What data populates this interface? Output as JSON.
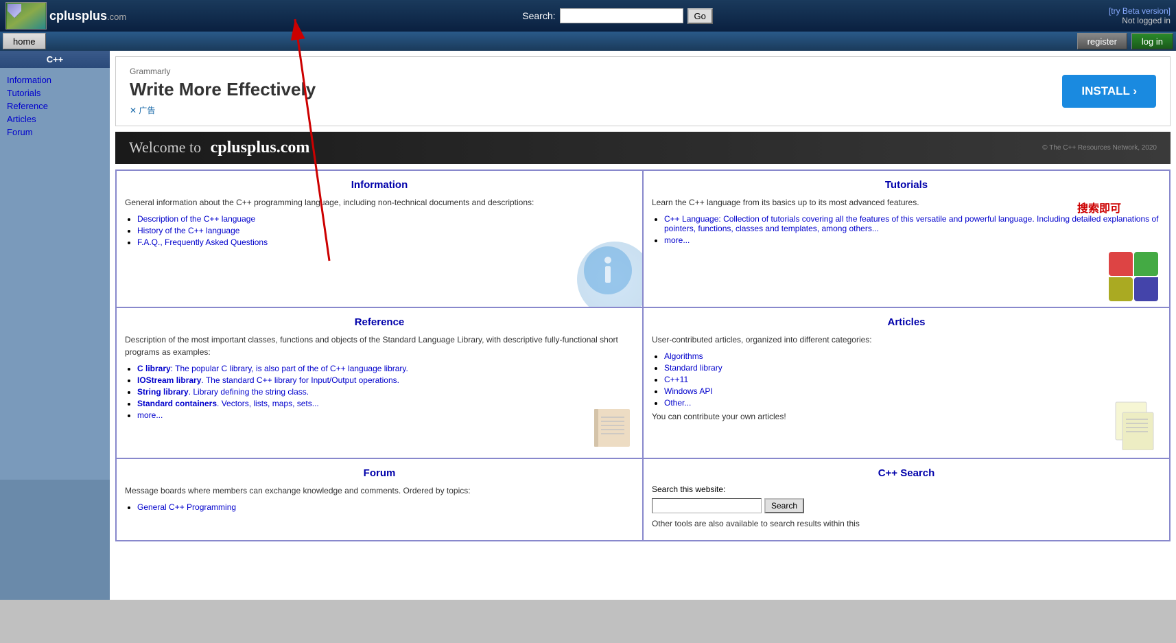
{
  "header": {
    "search_label": "Search:",
    "go_label": "Go",
    "beta_text": "[try Beta version]",
    "not_logged": "Not logged in",
    "home_label": "home",
    "register_label": "register",
    "login_label": "log in"
  },
  "logo": {
    "text": "cplusplus",
    "com": ".com"
  },
  "sidebar": {
    "title": "C++",
    "links": [
      {
        "label": "Information",
        "href": "#"
      },
      {
        "label": "Tutorials",
        "href": "#"
      },
      {
        "label": "Reference",
        "href": "#"
      },
      {
        "label": "Articles",
        "href": "#"
      },
      {
        "label": "Forum",
        "href": "#"
      }
    ]
  },
  "ad": {
    "brand": "Grammarly",
    "title": "Write More Effectively",
    "footer": "✕ 广告",
    "install_label": "INSTALL ›"
  },
  "welcome": {
    "text": "Welcome to",
    "brand": "cplusplus.com",
    "copyright": "© The C++ Resources Network, 2020"
  },
  "grid": {
    "cells": [
      {
        "id": "information",
        "title": "Information",
        "desc": "General information about the C++ programming language, including non-technical documents and descriptions:",
        "links": [
          "Description of the C++ language",
          "History of the C++ language",
          "F.A.Q., Frequently Asked Questions"
        ]
      },
      {
        "id": "tutorials",
        "title": "Tutorials",
        "desc": "Learn the C++ language from its basics up to its most advanced features.",
        "links": [
          "C++ Language: Collection of tutorials covering all the features of this versatile and powerful language. Including detailed explanations of pointers, functions, classes and templates, among others...",
          "more..."
        ]
      },
      {
        "id": "reference",
        "title": "Reference",
        "desc": "Description of the most important classes, functions and objects of the Standard Language Library, with descriptive fully-functional short programs as examples:",
        "links": [
          "C library: The popular C library, is also part of the of C++ language library.",
          "IOStream library. The standard C++ library for Input/Output operations.",
          "String library. Library defining the string class.",
          "Standard containers. Vectors, lists, maps, sets...",
          "more..."
        ]
      },
      {
        "id": "articles",
        "title": "Articles",
        "desc": "User-contributed articles, organized into different categories:",
        "links": [
          "Algorithms",
          "Standard library",
          "C++11",
          "Windows API",
          "Other..."
        ],
        "extra": "You can contribute your own articles!"
      },
      {
        "id": "forum",
        "title": "Forum",
        "desc": "Message boards where members can exchange knowledge and comments. Ordered by topics:",
        "links": [
          "General C++ Programming"
        ]
      },
      {
        "id": "cppsearch",
        "title": "C++ Search",
        "search_desc": "Search this website:",
        "search_btn": "Search",
        "extra_desc": "Other tools are also available to search results within this"
      }
    ]
  },
  "annotation": {
    "chinese": "搜索即可"
  }
}
